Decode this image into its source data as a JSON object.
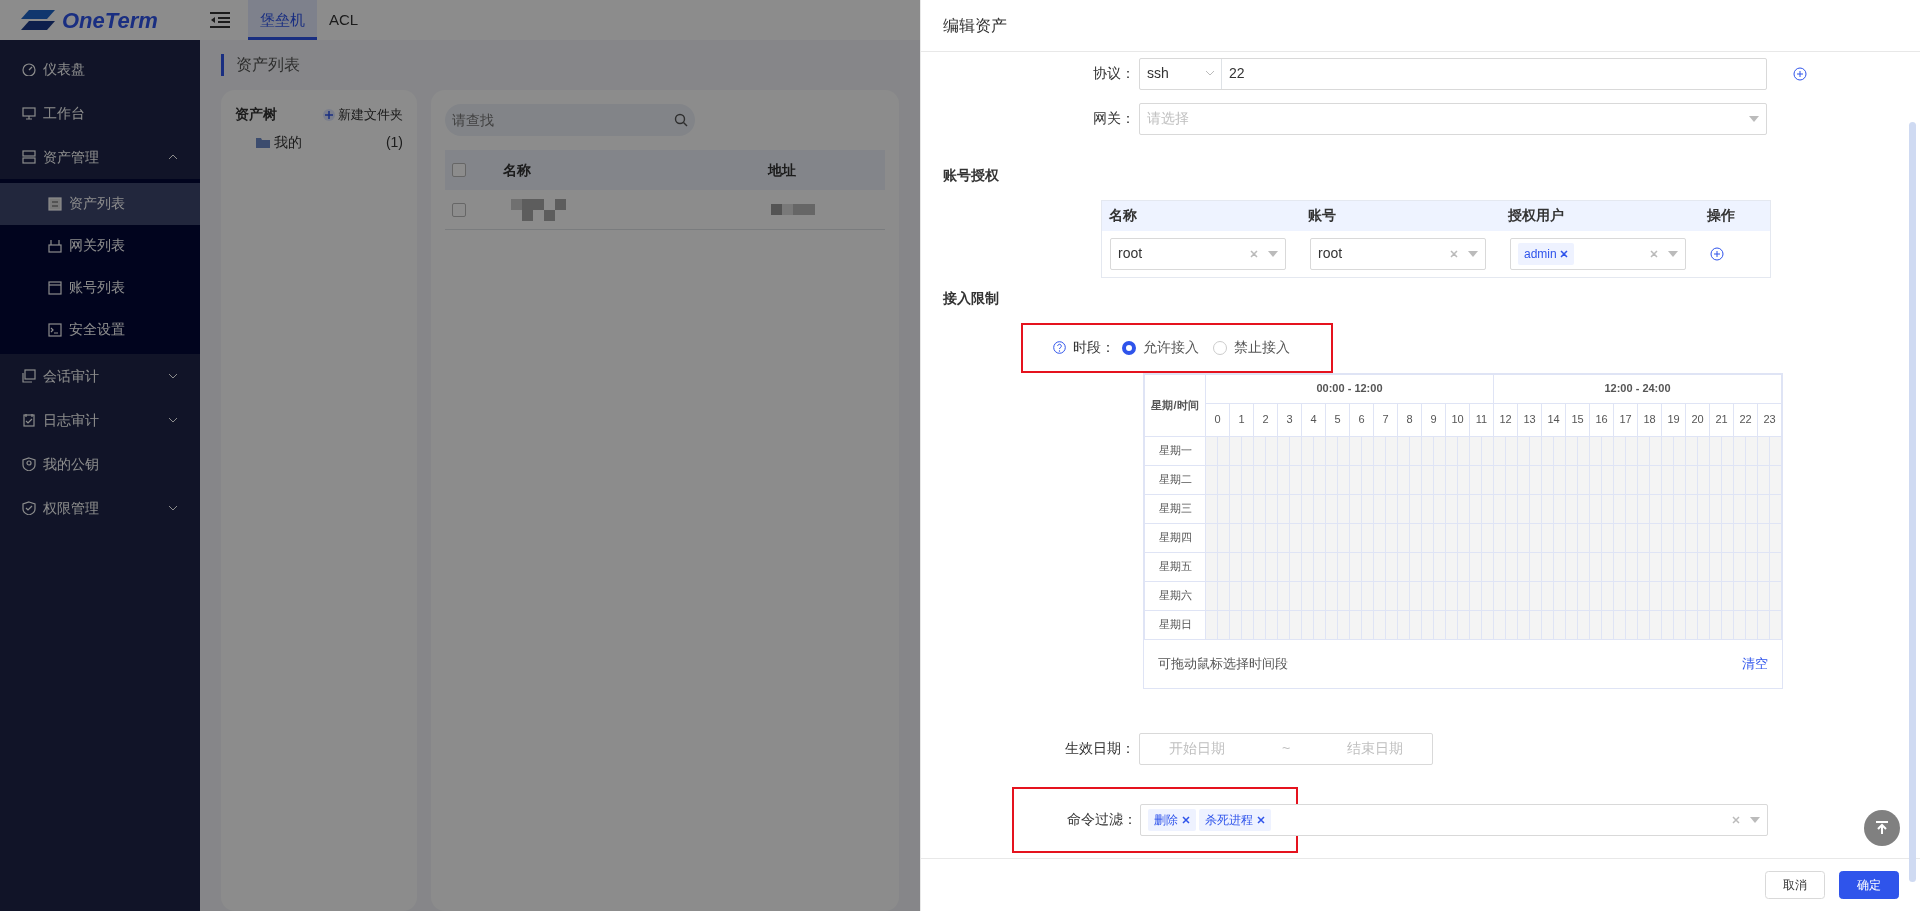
{
  "app": {
    "logo": "OneTerm",
    "top_tabs": [
      {
        "label": "堡垒机",
        "selected": true
      },
      {
        "label": "ACL",
        "selected": false
      }
    ]
  },
  "sidebar": {
    "items": [
      {
        "label": "仪表盘"
      },
      {
        "label": "工作台"
      },
      {
        "label": "资产管理",
        "expanded": true,
        "children": [
          {
            "label": "资产列表",
            "selected": true
          },
          {
            "label": "网关列表",
            "selected": false
          },
          {
            "label": "账号列表",
            "selected": false
          },
          {
            "label": "安全设置",
            "selected": false
          }
        ]
      },
      {
        "label": "会话审计",
        "expanded": false
      },
      {
        "label": "日志审计",
        "expanded": false
      },
      {
        "label": "我的公钥"
      },
      {
        "label": "权限管理",
        "expanded": false
      }
    ]
  },
  "page": {
    "title": "资产列表",
    "tree": {
      "title": "资产树",
      "new_folder": "新建文件夹",
      "nodes": [
        {
          "label": "我的",
          "count": "(1)"
        }
      ]
    },
    "list": {
      "search": {
        "placeholder": "请查找"
      },
      "header_checked": false,
      "columns": [
        "名称",
        "地址"
      ],
      "rows": [
        {
          "checked": false
        }
      ]
    }
  },
  "drawer": {
    "title": "编辑资产",
    "protocol": {
      "label": "协议：",
      "protocol": "ssh",
      "port": "22"
    },
    "gateway": {
      "label": "网关：",
      "placeholder": "请选择"
    },
    "accounts": {
      "heading": "账号授权",
      "columns": [
        "名称",
        "账号",
        "授权用户",
        "操作"
      ],
      "rows": [
        {
          "name": "root",
          "account": "root",
          "users": [
            "admin"
          ]
        }
      ]
    },
    "access": {
      "heading": "接入限制",
      "period": {
        "label": "时段：",
        "options": [
          {
            "label": "允许接入",
            "selected": true
          },
          {
            "label": "禁止接入",
            "selected": false
          }
        ]
      },
      "schedule": {
        "corner": "星期/时间",
        "halves": [
          "00:00 - 12:00",
          "12:00 - 24:00"
        ],
        "hours": [
          "0",
          "1",
          "2",
          "3",
          "4",
          "5",
          "6",
          "7",
          "8",
          "9",
          "10",
          "11",
          "12",
          "13",
          "14",
          "15",
          "16",
          "17",
          "18",
          "19",
          "20",
          "21",
          "22",
          "23"
        ],
        "days": [
          "星期一",
          "星期二",
          "星期三",
          "星期四",
          "星期五",
          "星期六",
          "星期日"
        ],
        "hint": "可拖动鼠标选择时间段",
        "clear": "清空"
      },
      "date": {
        "label": "生效日期：",
        "start_placeholder": "开始日期",
        "separator": "~",
        "end_placeholder": "结束日期"
      },
      "commands": {
        "label": "命令过滤：",
        "tags": [
          "删除",
          "杀死进程"
        ]
      }
    },
    "buttons": [
      {
        "label": "取消",
        "kind": "default"
      },
      {
        "label": "确定",
        "kind": "primary"
      }
    ]
  }
}
